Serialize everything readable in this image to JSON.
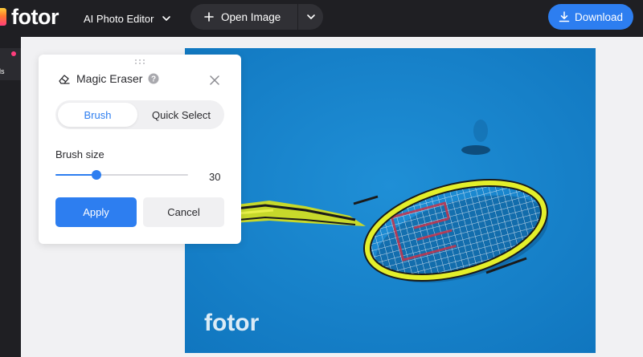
{
  "app": {
    "logo_text": "fotor",
    "ai_editor_label": "AI Photo Editor",
    "open_image_label": "Open Image",
    "download_label": "Download",
    "accent_color": "#2d7ef0"
  },
  "sidebar": {
    "tools_label": "ols"
  },
  "photo": {
    "watermark": "fotor",
    "subject": "tennis racket on blue court"
  },
  "panel": {
    "title": "Magic Eraser",
    "tabs": [
      {
        "label": "Brush",
        "active": true
      },
      {
        "label": "Quick Select",
        "active": false
      }
    ],
    "brush_size_label": "Brush size",
    "brush_size_value": "30",
    "brush_size_fraction": 0.31,
    "apply_label": "Apply",
    "cancel_label": "Cancel"
  }
}
